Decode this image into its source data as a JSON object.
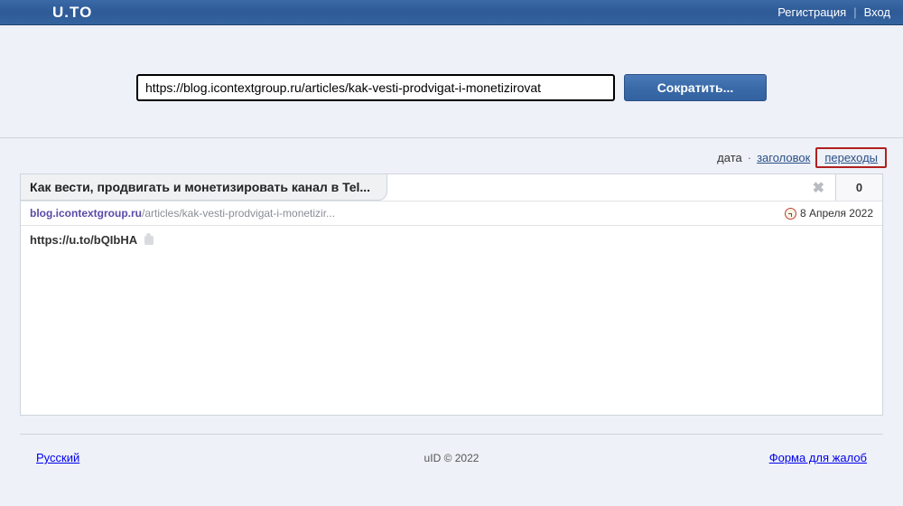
{
  "header": {
    "logo": "U.TO",
    "register": "Регистрация",
    "login": "Вход"
  },
  "shorten": {
    "url_value": "https://blog.icontextgroup.ru/articles/kak-vesti-prodvigat-i-monetizirovat",
    "button": "Сократить..."
  },
  "sort": {
    "date": "дата",
    "title": "заголовок",
    "clicks": "переходы"
  },
  "item": {
    "title": "Как вести, продвигать и монетизировать канал в Tel...",
    "domain": "blog.icontextgroup.ru",
    "path": "/articles/kak-vesti-prodvigat-i-monetizir...",
    "date": "8 Апреля 2022",
    "clicks": "0",
    "short_url": "https://u.to/bQIbHA"
  },
  "footer": {
    "language": "Русский",
    "copyright": "uID © 2022",
    "complaint": "Форма для жалоб"
  }
}
